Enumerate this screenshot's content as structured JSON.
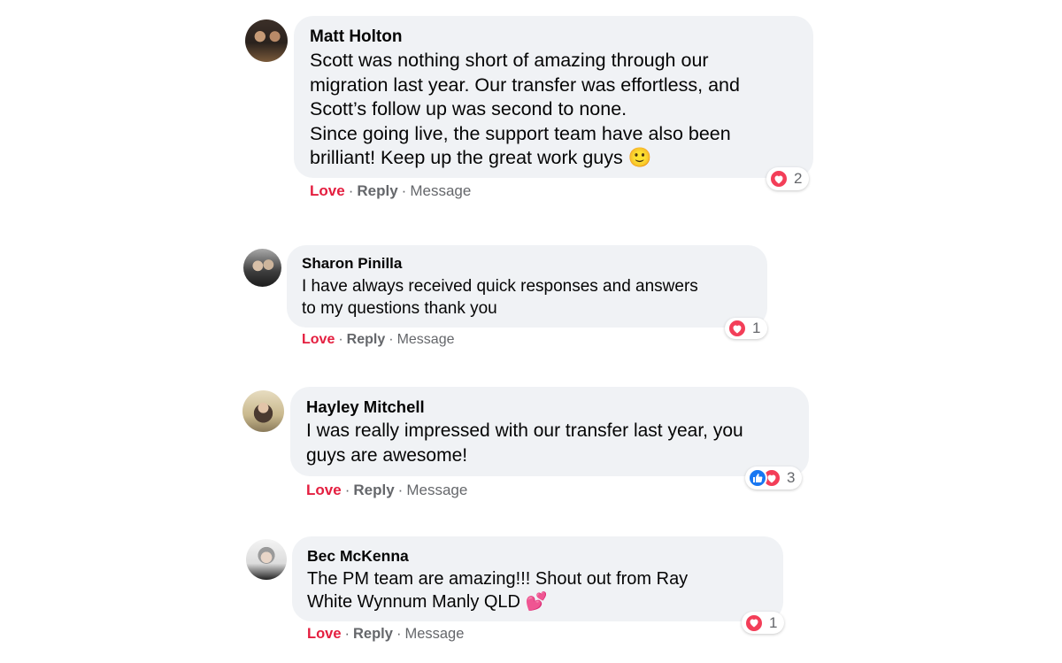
{
  "comments": [
    {
      "name": "Matt Holton",
      "text": "Scott was nothing short of amazing through our\nmigration last year. Our transfer was effortless, and\nScott’s follow up was second to none.\nSince going live, the support team have also been\nbrilliant! Keep up the great work guys 🙂",
      "reaction_count": "2",
      "reactions": [
        "heart-icon"
      ],
      "love_label": "Love",
      "reply_label": "Reply",
      "message_label": "Message",
      "separator": "·"
    },
    {
      "name": "Sharon Pinilla",
      "text": "I have always received quick responses and answers\nto my questions thank you",
      "reaction_count": "1",
      "reactions": [
        "heart-icon"
      ],
      "love_label": "Love",
      "reply_label": "Reply",
      "message_label": "Message",
      "separator": "·"
    },
    {
      "name": "Hayley Mitchell",
      "text": "I was really impressed with our transfer last year, you\nguys are awesome!",
      "reaction_count": "3",
      "reactions": [
        "like-icon",
        "heart-icon"
      ],
      "love_label": "Love",
      "reply_label": "Reply",
      "message_label": "Message",
      "separator": "·"
    },
    {
      "name": "Bec McKenna",
      "text": "The PM team are amazing!!! Shout out from Ray\nWhite Wynnum Manly QLD 💕",
      "reaction_count": "1",
      "reactions": [
        "heart-icon"
      ],
      "love_label": "Love",
      "reply_label": "Reply",
      "message_label": "Message",
      "separator": "·"
    }
  ],
  "colors": {
    "bubble": "#f0f2f5",
    "love": "#e41e3f",
    "meta": "#65676b",
    "heart": "#f33e58",
    "like": "#1877f2"
  }
}
